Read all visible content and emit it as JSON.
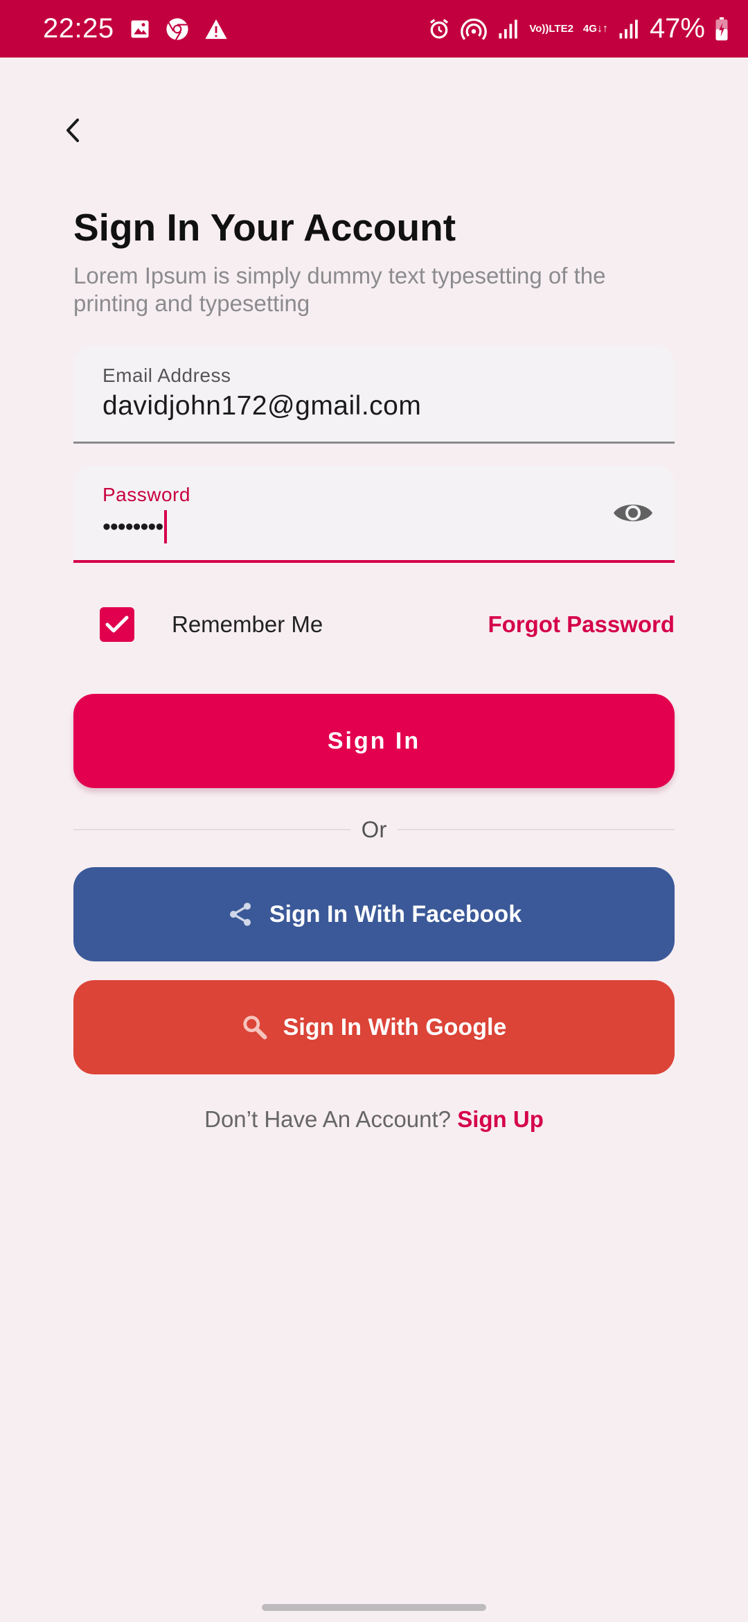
{
  "status_bar": {
    "time": "22:25",
    "battery": "47%",
    "network_top": "Vo))",
    "network_bottom": "LTE2",
    "data_type": "4G",
    "icons": [
      "image-icon",
      "chrome-icon",
      "warning-icon",
      "alarm-icon",
      "hotspot-icon",
      "signal-icon",
      "signal-icon",
      "battery-icon"
    ]
  },
  "header": {
    "title": "Sign In Your Account",
    "subtitle": "Lorem Ipsum is simply dummy text typesetting of the printing and typesetting"
  },
  "form": {
    "email_label": "Email Address",
    "email_value": "davidjohn172@gmail.com",
    "password_label": "Password",
    "password_mask": "••••••••",
    "remember_label": "Remember Me",
    "remember_checked": true,
    "forgot_label": "Forgot Password"
  },
  "actions": {
    "signin_label": "Sign In",
    "or_label": "Or",
    "facebook_label": "Sign In With Facebook",
    "google_label": "Sign In With Google"
  },
  "footer": {
    "prompt": "Don’t Have An Account?",
    "signup_label": "Sign Up"
  },
  "colors": {
    "accent": "#E3004F",
    "status_bar": "#C3003F",
    "background": "#F7EEF2",
    "facebook": "#3B5998",
    "google": "#DB4437"
  }
}
